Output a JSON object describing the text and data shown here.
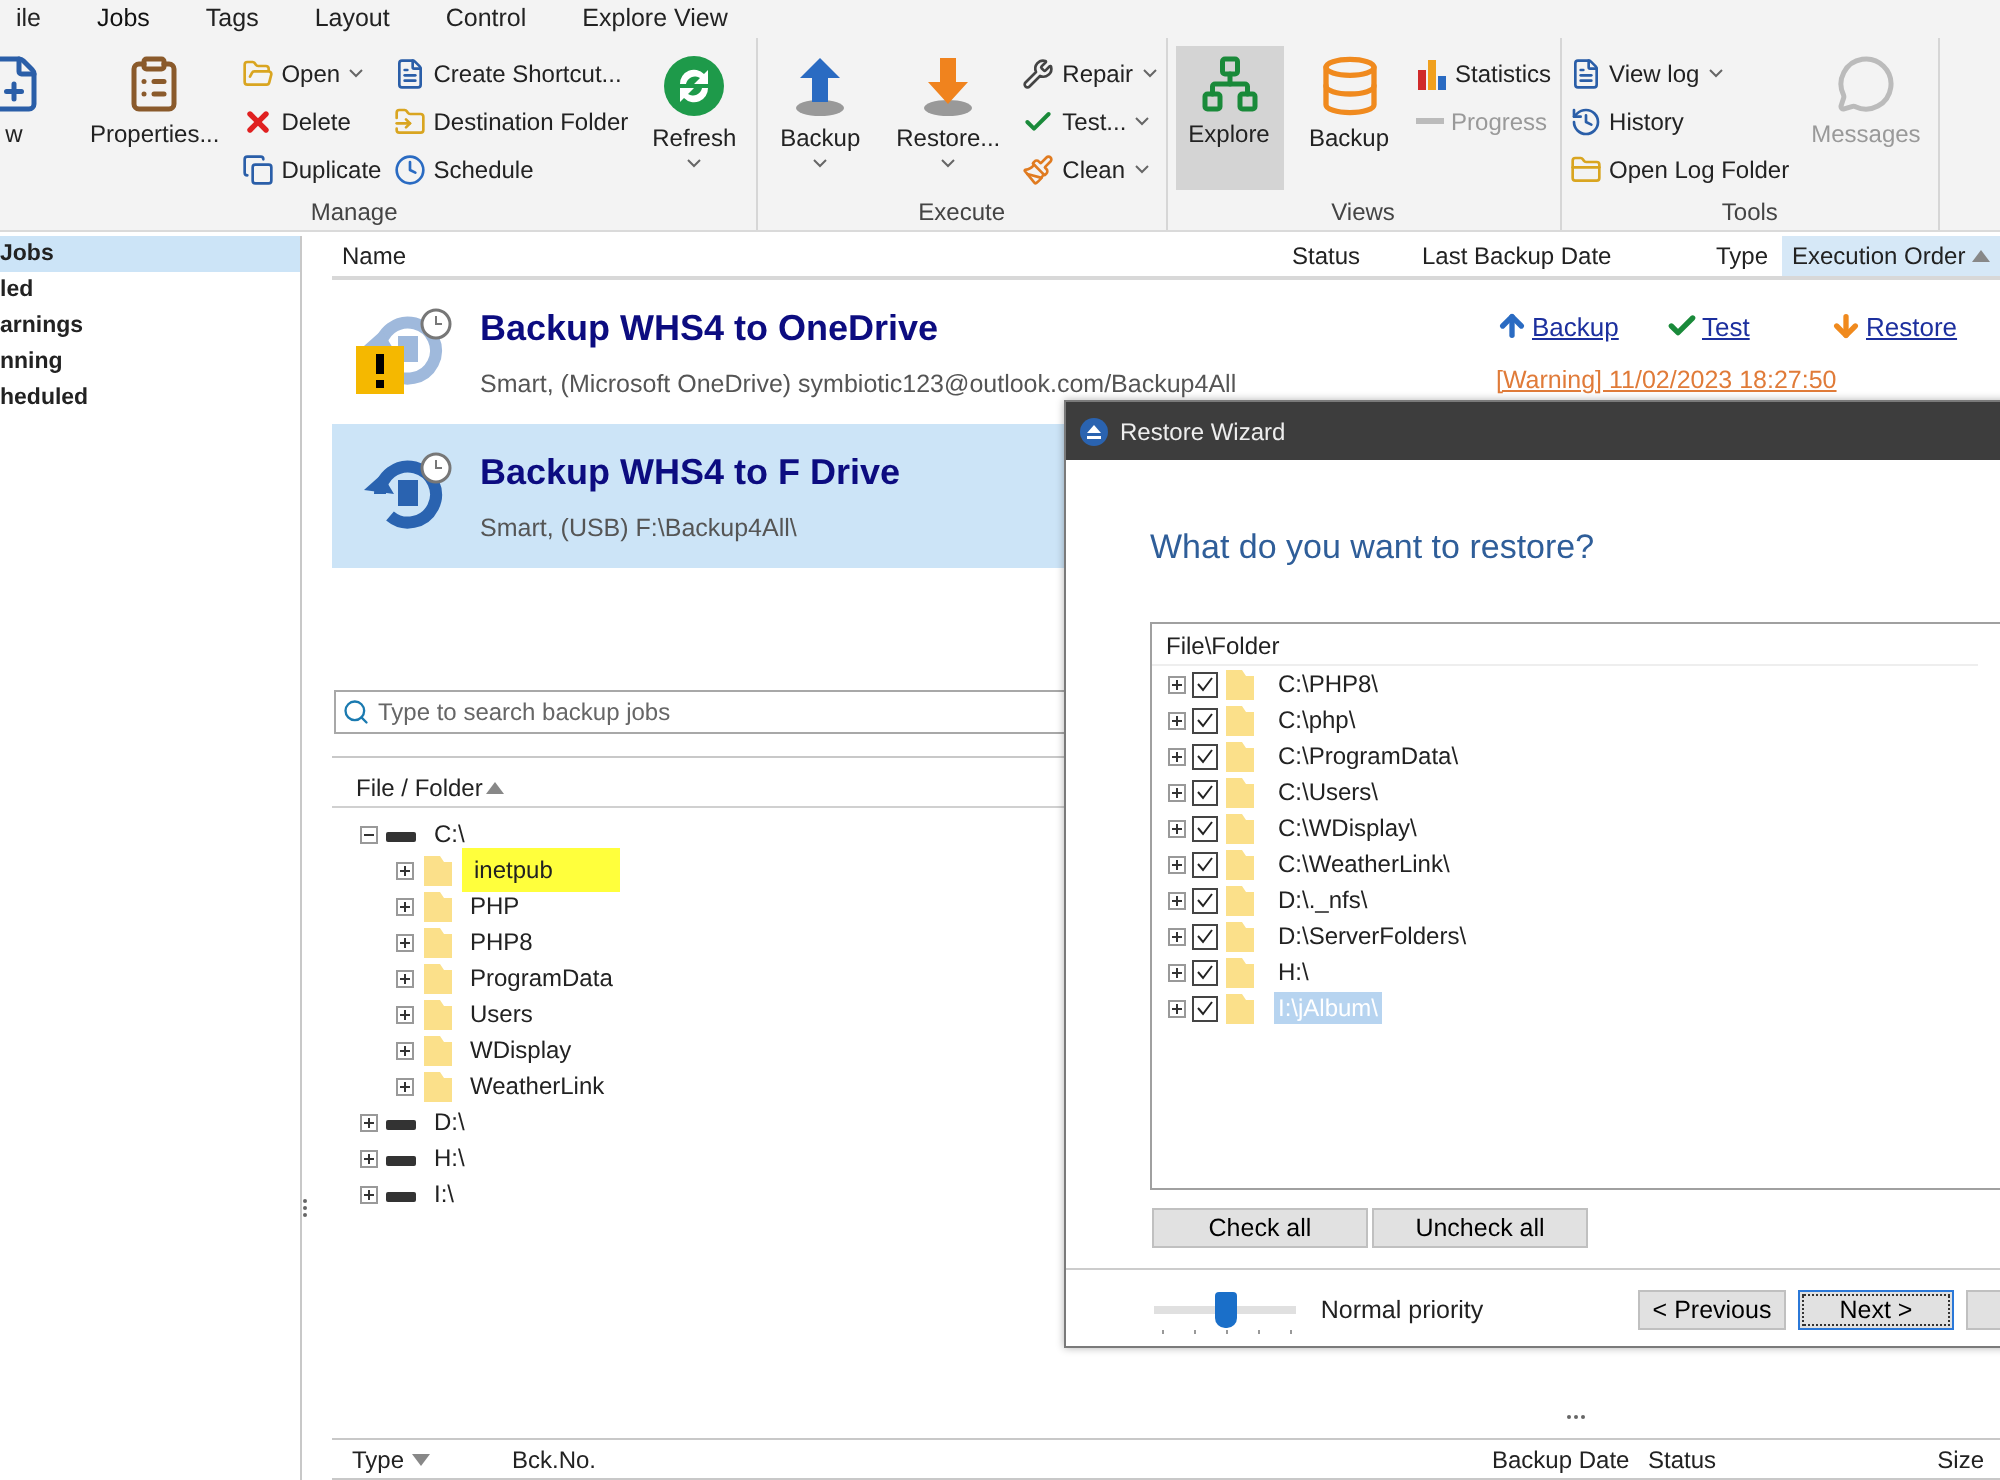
{
  "ribbon": {
    "tabs": [
      {
        "label": "ile",
        "selected": false
      },
      {
        "label": "Jobs",
        "selected": true
      },
      {
        "label": "Tags",
        "selected": false
      },
      {
        "label": "Layout",
        "selected": false
      },
      {
        "label": "Control",
        "selected": false
      },
      {
        "label": "Explore View",
        "selected": false
      }
    ],
    "groups": [
      {
        "label": "Manage",
        "columns": [
          {
            "kind": "large",
            "label": "w",
            "dropdown": false,
            "selected": false,
            "disabled": false
          },
          {
            "kind": "large",
            "label": "Properties...",
            "dropdown": false,
            "selected": false,
            "disabled": false
          },
          {
            "kind": "stack",
            "items": [
              {
                "label": "Open",
                "dropdown": true
              },
              {
                "label": "Delete",
                "dropdown": false
              },
              {
                "label": "Duplicate",
                "dropdown": false
              }
            ]
          },
          {
            "kind": "stack",
            "items": [
              {
                "label": "Create Shortcut...",
                "dropdown": false
              },
              {
                "label": "Destination Folder",
                "dropdown": false
              },
              {
                "label": "Schedule",
                "dropdown": false
              }
            ]
          },
          {
            "kind": "large",
            "label": "Refresh",
            "dropdown": true,
            "selected": false,
            "disabled": false
          }
        ]
      },
      {
        "label": "Execute",
        "columns": [
          {
            "kind": "large",
            "label": "Backup",
            "dropdown": true,
            "selected": false,
            "disabled": false
          },
          {
            "kind": "large",
            "label": "Restore...",
            "dropdown": true,
            "selected": false,
            "disabled": false
          },
          {
            "kind": "stack",
            "items": [
              {
                "label": "Repair",
                "dropdown": true
              },
              {
                "label": "Test...",
                "dropdown": true
              },
              {
                "label": "Clean",
                "dropdown": true
              }
            ]
          }
        ]
      },
      {
        "label": "Views",
        "columns": [
          {
            "kind": "large",
            "label": "Explore",
            "dropdown": false,
            "selected": true,
            "disabled": false
          },
          {
            "kind": "large",
            "label": "Backup",
            "dropdown": false,
            "selected": false,
            "disabled": false
          },
          {
            "kind": "stack",
            "items": [
              {
                "label": "Statistics",
                "dropdown": false,
                "disabled": false
              },
              {
                "label": "Progress",
                "dropdown": false,
                "disabled": true
              }
            ]
          }
        ]
      },
      {
        "label": "Tools",
        "columns": [
          {
            "kind": "stack",
            "items": [
              {
                "label": "View log",
                "dropdown": true
              },
              {
                "label": "History",
                "dropdown": false
              },
              {
                "label": "Open Log Folder",
                "dropdown": false
              }
            ]
          },
          {
            "kind": "large",
            "label": "Messages",
            "dropdown": false,
            "selected": false,
            "disabled": true
          }
        ]
      }
    ]
  },
  "sidebar": {
    "items": [
      {
        "label": "Jobs",
        "selected": true
      },
      {
        "label": "led",
        "selected": false
      },
      {
        "label": "arnings",
        "selected": false
      },
      {
        "label": "nning",
        "selected": false
      },
      {
        "label": "heduled",
        "selected": false
      }
    ]
  },
  "jobs": {
    "columns": [
      {
        "label": "Name",
        "sorted": false
      },
      {
        "label": "Status",
        "sorted": false
      },
      {
        "label": "Last Backup Date",
        "sorted": false
      },
      {
        "label": "Type",
        "sorted": false
      },
      {
        "label": "Execution Order",
        "sorted": true
      }
    ],
    "rows": [
      {
        "title": "Backup WHS4 to OneDrive",
        "subtitle": "Smart, (Microsoft OneDrive) symbiotic123@outlook.com/Backup4All",
        "warning": true,
        "selected": false,
        "actions": [
          {
            "kind": "backup",
            "label": "Backup"
          },
          {
            "kind": "test",
            "label": "Test"
          },
          {
            "kind": "restore",
            "label": "Restore"
          }
        ],
        "status": "[Warning] 11/02/2023 18:27:50"
      },
      {
        "title": "Backup WHS4 to F Drive",
        "subtitle": "Smart, (USB) F:\\Backup4All\\",
        "warning": false,
        "selected": true
      }
    ]
  },
  "search": {
    "placeholder": "Type to search backup jobs"
  },
  "file_tree": {
    "header": "File / Folder",
    "nodes": [
      {
        "kind": "drive",
        "label": "C:\\",
        "expanded": true,
        "highlighted": false,
        "children": [
          {
            "kind": "folder",
            "label": "inetpub",
            "expanded": false,
            "highlighted": true
          },
          {
            "kind": "folder",
            "label": "PHP",
            "expanded": false,
            "highlighted": false
          },
          {
            "kind": "folder",
            "label": "PHP8",
            "expanded": false,
            "highlighted": false
          },
          {
            "kind": "folder",
            "label": "ProgramData",
            "expanded": false,
            "highlighted": false
          },
          {
            "kind": "folder",
            "label": "Users",
            "expanded": false,
            "highlighted": false
          },
          {
            "kind": "folder",
            "label": "WDisplay",
            "expanded": false,
            "highlighted": false
          },
          {
            "kind": "folder",
            "label": "WeatherLink",
            "expanded": false,
            "highlighted": false
          }
        ]
      },
      {
        "kind": "drive",
        "label": "D:\\",
        "expanded": false,
        "highlighted": false
      },
      {
        "kind": "drive",
        "label": "H:\\",
        "expanded": false,
        "highlighted": false
      },
      {
        "kind": "drive",
        "label": "I:\\",
        "expanded": false,
        "highlighted": false
      }
    ]
  },
  "versions_table": {
    "columns": [
      "Type",
      "Bck.No.",
      "Backup Date",
      "Status",
      "Size"
    ]
  },
  "restore_wizard": {
    "title": "Restore Wizard",
    "heading": "What do you want to restore?",
    "list_header": "File\\Folder",
    "items": [
      {
        "label": "C:\\PHP8\\",
        "checked": true,
        "selected": false
      },
      {
        "label": "C:\\php\\",
        "checked": true,
        "selected": false
      },
      {
        "label": "C:\\ProgramData\\",
        "checked": true,
        "selected": false
      },
      {
        "label": "C:\\Users\\",
        "checked": true,
        "selected": false
      },
      {
        "label": "C:\\WDisplay\\",
        "checked": true,
        "selected": false
      },
      {
        "label": "C:\\WeatherLink\\",
        "checked": true,
        "selected": false
      },
      {
        "label": "D:\\._nfs\\",
        "checked": true,
        "selected": false
      },
      {
        "label": "D:\\ServerFolders\\",
        "checked": true,
        "selected": false
      },
      {
        "label": "H:\\",
        "checked": true,
        "selected": false
      },
      {
        "label": "I:\\jAlbum\\",
        "checked": true,
        "selected": true
      }
    ],
    "check_all": "Check all",
    "uncheck_all": "Uncheck all",
    "priority": {
      "level": 0.5,
      "label": "Normal priority"
    },
    "buttons": [
      {
        "label": "< Previous",
        "focused": false
      },
      {
        "label": "Next >",
        "focused": true
      }
    ]
  }
}
